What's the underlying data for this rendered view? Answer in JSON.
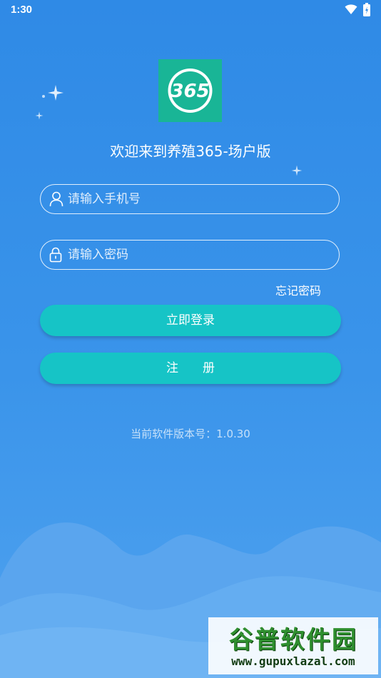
{
  "status_bar": {
    "time": "1:30",
    "icons": [
      "wifi-icon",
      "battery-icon"
    ]
  },
  "logo": {
    "text": "365",
    "background": "#19b596"
  },
  "title": "欢迎来到养殖365-场户版",
  "phone_field": {
    "placeholder": "请输入手机号",
    "value": "",
    "icon": "user-icon"
  },
  "password_field": {
    "placeholder": "请输入密码",
    "value": "",
    "icon": "lock-icon"
  },
  "forgot_password": "忘记密码",
  "login_button": "立即登录",
  "register_button": "注　　册",
  "version": "当前软件版本号：1.0.30",
  "watermark": {
    "title": "谷普软件园",
    "url": "www.gupuxlazal.com"
  },
  "colors": {
    "background": "#2f8ae6",
    "button": "#16c4c6",
    "logo": "#19b596"
  }
}
